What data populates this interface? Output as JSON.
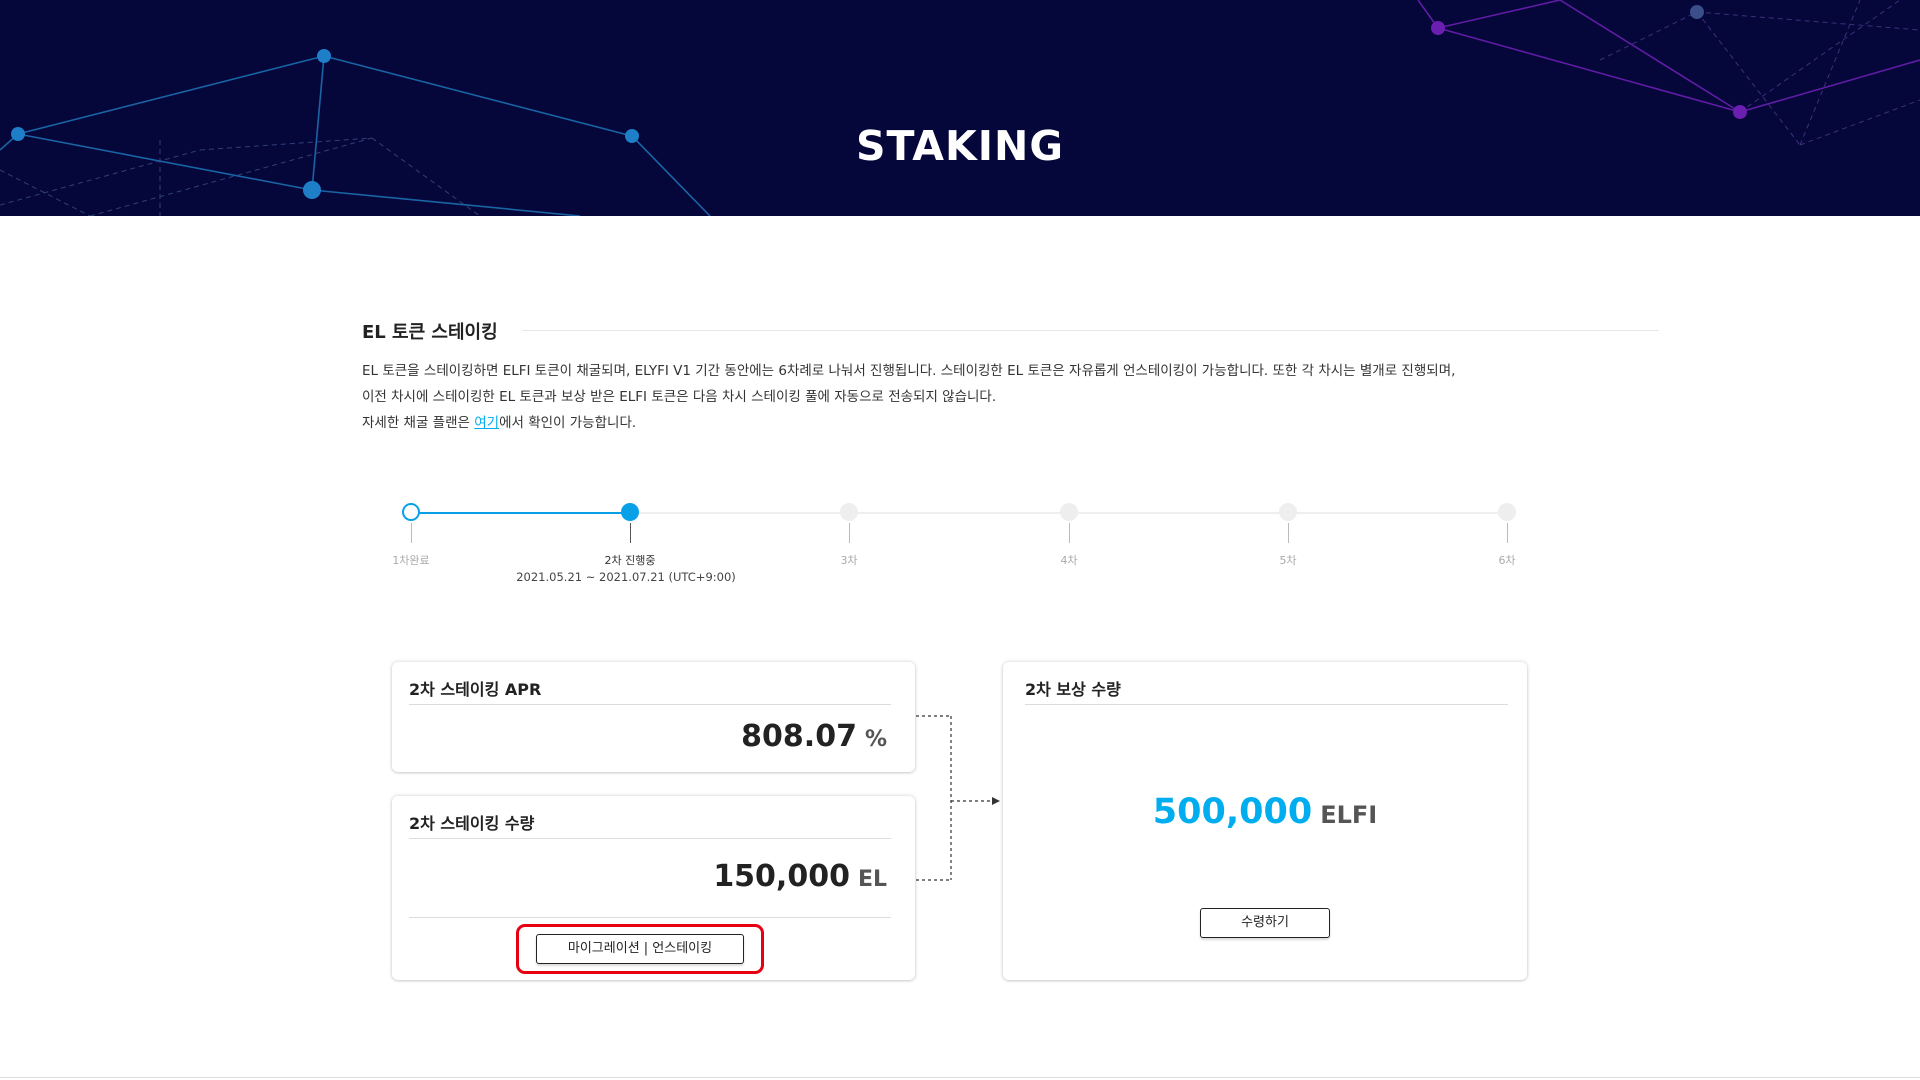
{
  "banner": {
    "title": "STAKING"
  },
  "section": {
    "title": "EL 토큰 스테이킹",
    "desc_line1": "EL 토큰을 스테이킹하면 ELFI 토큰이 채굴되며, ELYFI V1 기간 동안에는 6차례로 나눠서 진행됩니다. 스테이킹한 EL 토큰은 자유롭게 언스테이킹이 가능합니다. 또한 각 차시는 별개로 진행되며,",
    "desc_line2": "이전 차시에 스테이킹한 EL 토큰과 보상 받은 ELFI 토큰은 다음 차시 스테이킹 풀에 자동으로 전송되지 않습니다.",
    "desc_line3_prefix": "자세한 채굴 플랜은 ",
    "desc_line3_link": "여기",
    "desc_line3_suffix": "에서 확인이 가능합니다."
  },
  "timeline": {
    "stages": [
      {
        "label": "1차완료",
        "state": "completed"
      },
      {
        "label": "2차 진행중",
        "state": "active"
      },
      {
        "label": "3차",
        "state": "upcoming"
      },
      {
        "label": "4차",
        "state": "upcoming"
      },
      {
        "label": "5차",
        "state": "upcoming"
      },
      {
        "label": "6차",
        "state": "upcoming"
      }
    ],
    "active_period": "2021.05.21 ~ 2021.07.21 (UTC+9:00)"
  },
  "apr_card": {
    "title": "2차 스테이킹 APR",
    "value": "808.07",
    "unit": "%"
  },
  "staking_card": {
    "title": "2차 스테이킹 수량",
    "value": "150,000",
    "unit": "EL",
    "button_label": "마이그레이션 | 언스테이킹"
  },
  "reward_card": {
    "title": "2차 보상 수량",
    "value": "500,000",
    "unit": "ELFI",
    "button_label": "수령하기"
  },
  "colors": {
    "banner_bg": "#05063a",
    "accent": "#00aef0",
    "active_dot": "#0aa0e8",
    "highlight": "#e60012"
  }
}
